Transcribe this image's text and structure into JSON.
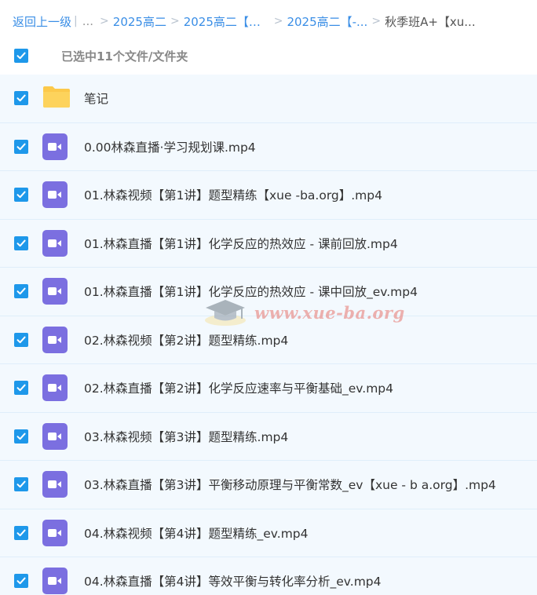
{
  "breadcrumb": {
    "back": "返回上一级",
    "sep_bar": "|",
    "ellipsis": "...",
    "crumbs": [
      "2025高二",
      "2025高二【化...",
      "2025高二【-..."
    ],
    "current": "秋季班A+【xu..."
  },
  "selection": {
    "text": "已选中11个文件/文件夹"
  },
  "files": [
    {
      "name": "笔记",
      "type": "folder"
    },
    {
      "name": "0.00林森直播·学习规划课.mp4",
      "type": "video"
    },
    {
      "name": "01.林森视频【第1讲】题型精练【xue -ba.org】.mp4",
      "type": "video"
    },
    {
      "name": "01.林森直播【第1讲】化学反应的热效应 - 课前回放.mp4",
      "type": "video"
    },
    {
      "name": "01.林森直播【第1讲】化学反应的热效应 - 课中回放_ev.mp4",
      "type": "video"
    },
    {
      "name": "02.林森视频【第2讲】题型精练.mp4",
      "type": "video"
    },
    {
      "name": "02.林森直播【第2讲】化学反应速率与平衡基础_ev.mp4",
      "type": "video"
    },
    {
      "name": "03.林森视频【第3讲】题型精练.mp4",
      "type": "video"
    },
    {
      "name": "03.林森直播【第3讲】平衡移动原理与平衡常数_ev【xue - b a.org】.mp4",
      "type": "video"
    },
    {
      "name": "04.林森视频【第4讲】题型精练_ev.mp4",
      "type": "video"
    },
    {
      "name": "04.林森直播【第4讲】等效平衡与转化率分析_ev.mp4",
      "type": "video"
    }
  ],
  "watermark": {
    "text": "www.xue-ba.org"
  },
  "colors": {
    "checkbox": "#1e98ea",
    "link": "#3a8ee6",
    "video_icon": "#7b6fe0",
    "folder": "#fcc94a",
    "row_bg": "#f3f9fe"
  }
}
